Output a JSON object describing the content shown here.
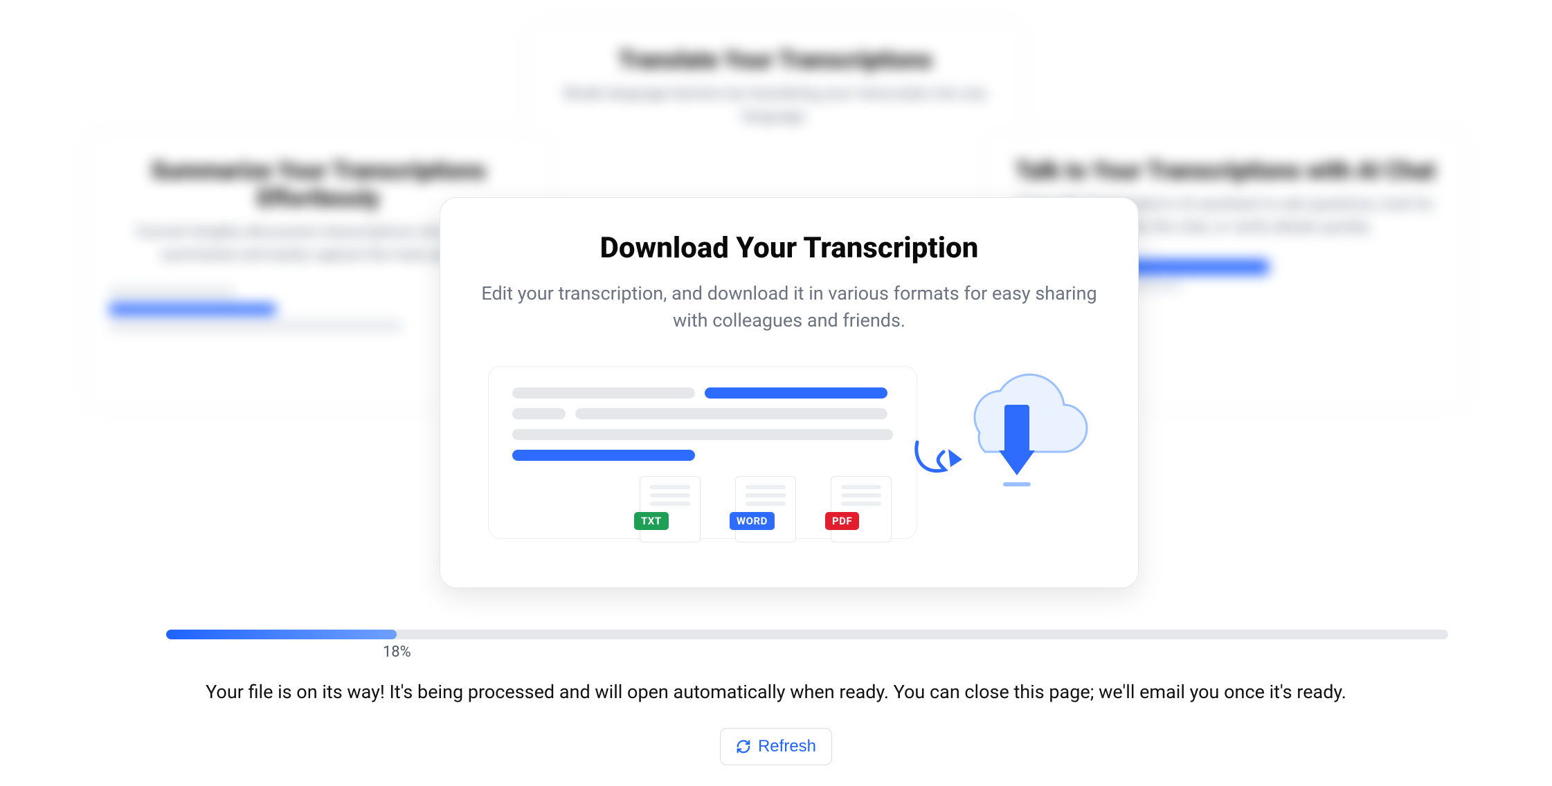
{
  "bg_cards": {
    "top": {
      "title": "Translate Your Transcriptions",
      "sub": "Break language barriers by translating your transcripts into any language."
    },
    "left": {
      "title": "Summarize Your Transcriptions Effortlessly",
      "sub": "Convert lengthy discussion transcriptions into concise summaries and easily capture the main points."
    },
    "right": {
      "title": "Talk to Your Transcriptions with AI Chat",
      "sub": "Chat with Transkriptor's AI assistant to ask questions, look for info within the chat, or verify details quickly."
    }
  },
  "focus": {
    "title": "Download Your Transcription",
    "sub": "Edit your transcription, and download it in various formats for easy sharing with colleagues and friends.",
    "formats": {
      "txt": "TXT",
      "word": "WORD",
      "pdf": "PDF"
    }
  },
  "progress": {
    "percent": 18,
    "label": "18%"
  },
  "status_text": "Your file is on its way! It's being processed and will open automatically when ready. You can close this page; we'll email you once it's ready.",
  "refresh_label": "Refresh",
  "colors": {
    "accent": "#1f63ff"
  }
}
